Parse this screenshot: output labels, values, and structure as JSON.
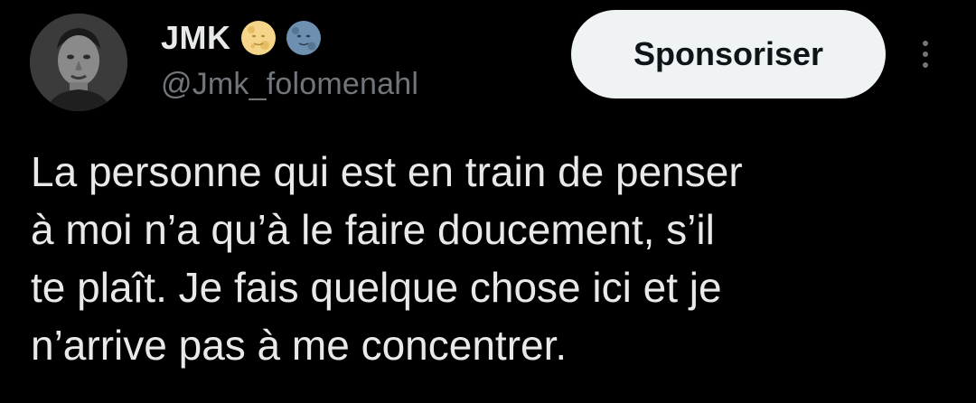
{
  "user": {
    "display_name": "JMK",
    "handle": "@Jmk_folomenahl",
    "badges": [
      "full-moon-face-icon",
      "new-moon-face-icon"
    ]
  },
  "actions": {
    "sponsor_label": "Sponsoriser",
    "more_icon": "more-vertical-icon"
  },
  "tweet": {
    "lines": [
      "La personne qui est en train de penser",
      "à moi n’a qu’à le faire doucement, s’il",
      "te plaît. Je fais quelque chose ici et je",
      "n’arrive pas à me concentrer."
    ]
  },
  "colors": {
    "background": "#000000",
    "primary_text": "#e7e9ea",
    "secondary_text": "#71767b",
    "button_bg": "#eff3f4",
    "button_text": "#0f1419"
  }
}
